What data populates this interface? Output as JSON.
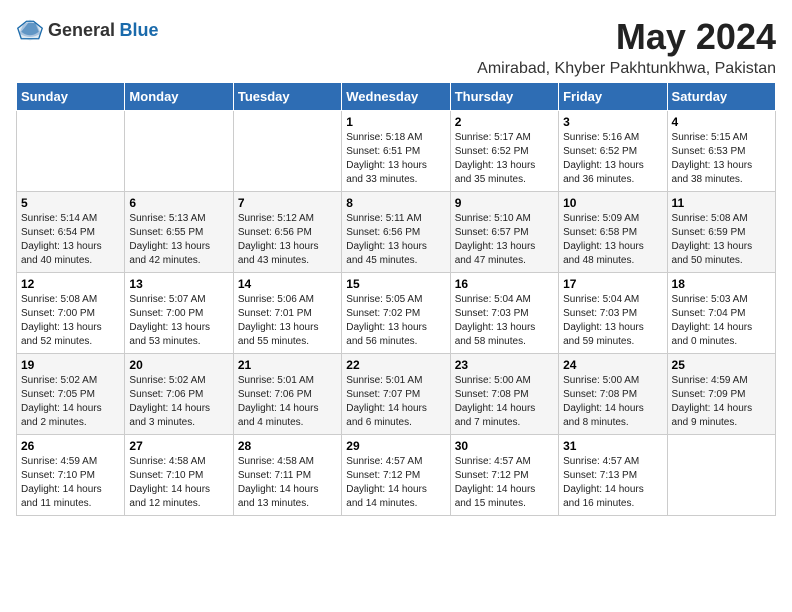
{
  "header": {
    "logo_general": "General",
    "logo_blue": "Blue",
    "title": "May 2024",
    "subtitle": "Amirabad, Khyber Pakhtunkhwa, Pakistan"
  },
  "weekdays": [
    "Sunday",
    "Monday",
    "Tuesday",
    "Wednesday",
    "Thursday",
    "Friday",
    "Saturday"
  ],
  "weeks": [
    [
      {
        "day": "",
        "info": ""
      },
      {
        "day": "",
        "info": ""
      },
      {
        "day": "",
        "info": ""
      },
      {
        "day": "1",
        "info": "Sunrise: 5:18 AM\nSunset: 6:51 PM\nDaylight: 13 hours\nand 33 minutes."
      },
      {
        "day": "2",
        "info": "Sunrise: 5:17 AM\nSunset: 6:52 PM\nDaylight: 13 hours\nand 35 minutes."
      },
      {
        "day": "3",
        "info": "Sunrise: 5:16 AM\nSunset: 6:52 PM\nDaylight: 13 hours\nand 36 minutes."
      },
      {
        "day": "4",
        "info": "Sunrise: 5:15 AM\nSunset: 6:53 PM\nDaylight: 13 hours\nand 38 minutes."
      }
    ],
    [
      {
        "day": "5",
        "info": "Sunrise: 5:14 AM\nSunset: 6:54 PM\nDaylight: 13 hours\nand 40 minutes."
      },
      {
        "day": "6",
        "info": "Sunrise: 5:13 AM\nSunset: 6:55 PM\nDaylight: 13 hours\nand 42 minutes."
      },
      {
        "day": "7",
        "info": "Sunrise: 5:12 AM\nSunset: 6:56 PM\nDaylight: 13 hours\nand 43 minutes."
      },
      {
        "day": "8",
        "info": "Sunrise: 5:11 AM\nSunset: 6:56 PM\nDaylight: 13 hours\nand 45 minutes."
      },
      {
        "day": "9",
        "info": "Sunrise: 5:10 AM\nSunset: 6:57 PM\nDaylight: 13 hours\nand 47 minutes."
      },
      {
        "day": "10",
        "info": "Sunrise: 5:09 AM\nSunset: 6:58 PM\nDaylight: 13 hours\nand 48 minutes."
      },
      {
        "day": "11",
        "info": "Sunrise: 5:08 AM\nSunset: 6:59 PM\nDaylight: 13 hours\nand 50 minutes."
      }
    ],
    [
      {
        "day": "12",
        "info": "Sunrise: 5:08 AM\nSunset: 7:00 PM\nDaylight: 13 hours\nand 52 minutes."
      },
      {
        "day": "13",
        "info": "Sunrise: 5:07 AM\nSunset: 7:00 PM\nDaylight: 13 hours\nand 53 minutes."
      },
      {
        "day": "14",
        "info": "Sunrise: 5:06 AM\nSunset: 7:01 PM\nDaylight: 13 hours\nand 55 minutes."
      },
      {
        "day": "15",
        "info": "Sunrise: 5:05 AM\nSunset: 7:02 PM\nDaylight: 13 hours\nand 56 minutes."
      },
      {
        "day": "16",
        "info": "Sunrise: 5:04 AM\nSunset: 7:03 PM\nDaylight: 13 hours\nand 58 minutes."
      },
      {
        "day": "17",
        "info": "Sunrise: 5:04 AM\nSunset: 7:03 PM\nDaylight: 13 hours\nand 59 minutes."
      },
      {
        "day": "18",
        "info": "Sunrise: 5:03 AM\nSunset: 7:04 PM\nDaylight: 14 hours\nand 0 minutes."
      }
    ],
    [
      {
        "day": "19",
        "info": "Sunrise: 5:02 AM\nSunset: 7:05 PM\nDaylight: 14 hours\nand 2 minutes."
      },
      {
        "day": "20",
        "info": "Sunrise: 5:02 AM\nSunset: 7:06 PM\nDaylight: 14 hours\nand 3 minutes."
      },
      {
        "day": "21",
        "info": "Sunrise: 5:01 AM\nSunset: 7:06 PM\nDaylight: 14 hours\nand 4 minutes."
      },
      {
        "day": "22",
        "info": "Sunrise: 5:01 AM\nSunset: 7:07 PM\nDaylight: 14 hours\nand 6 minutes."
      },
      {
        "day": "23",
        "info": "Sunrise: 5:00 AM\nSunset: 7:08 PM\nDaylight: 14 hours\nand 7 minutes."
      },
      {
        "day": "24",
        "info": "Sunrise: 5:00 AM\nSunset: 7:08 PM\nDaylight: 14 hours\nand 8 minutes."
      },
      {
        "day": "25",
        "info": "Sunrise: 4:59 AM\nSunset: 7:09 PM\nDaylight: 14 hours\nand 9 minutes."
      }
    ],
    [
      {
        "day": "26",
        "info": "Sunrise: 4:59 AM\nSunset: 7:10 PM\nDaylight: 14 hours\nand 11 minutes."
      },
      {
        "day": "27",
        "info": "Sunrise: 4:58 AM\nSunset: 7:10 PM\nDaylight: 14 hours\nand 12 minutes."
      },
      {
        "day": "28",
        "info": "Sunrise: 4:58 AM\nSunset: 7:11 PM\nDaylight: 14 hours\nand 13 minutes."
      },
      {
        "day": "29",
        "info": "Sunrise: 4:57 AM\nSunset: 7:12 PM\nDaylight: 14 hours\nand 14 minutes."
      },
      {
        "day": "30",
        "info": "Sunrise: 4:57 AM\nSunset: 7:12 PM\nDaylight: 14 hours\nand 15 minutes."
      },
      {
        "day": "31",
        "info": "Sunrise: 4:57 AM\nSunset: 7:13 PM\nDaylight: 14 hours\nand 16 minutes."
      },
      {
        "day": "",
        "info": ""
      }
    ]
  ]
}
